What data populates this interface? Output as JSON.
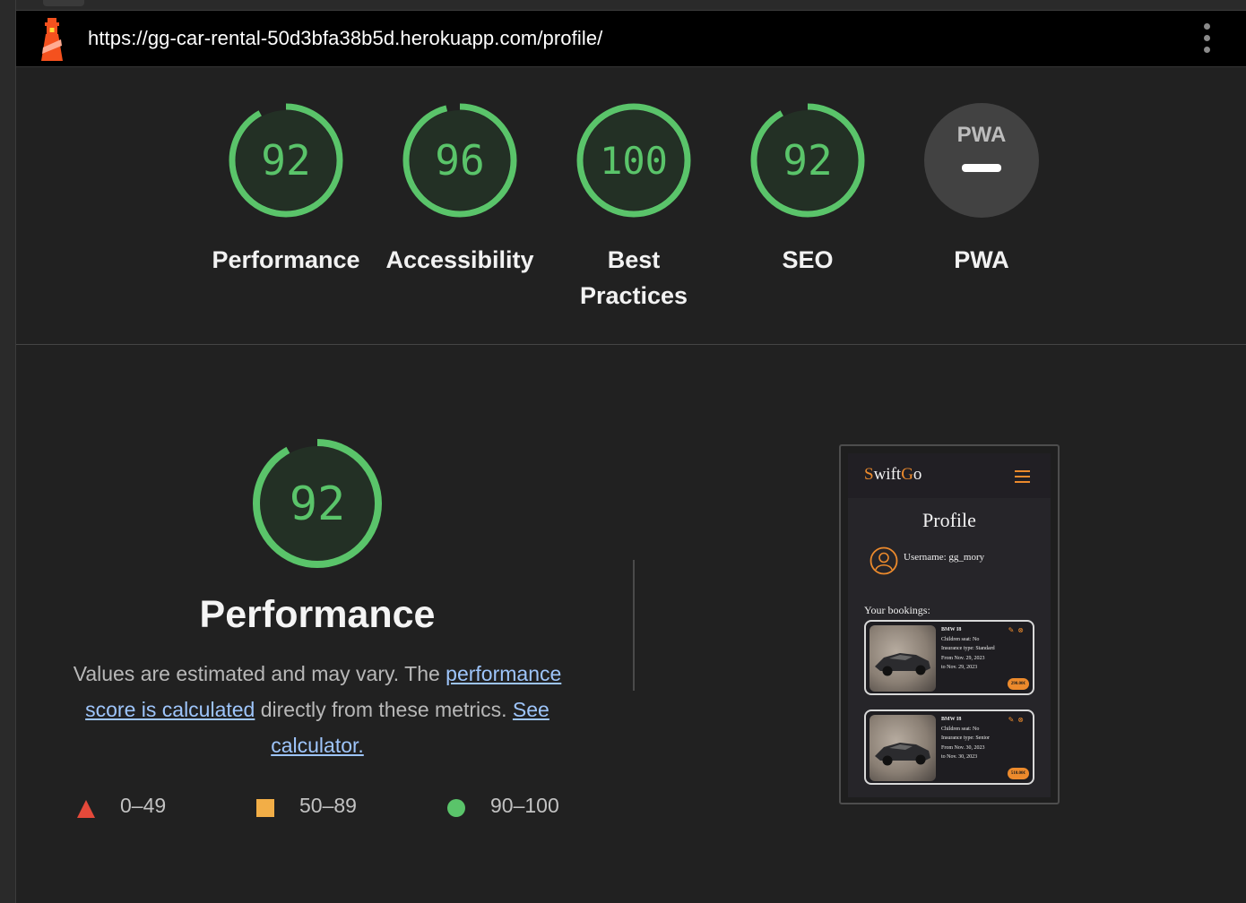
{
  "url": "https://gg-car-rental-50d3bfa38b5d.herokuapp.com/profile/",
  "colors": {
    "good": "#5ac46a",
    "average": "#f2ae47",
    "poor": "#e5493a",
    "background": "#212121",
    "link": "#9ec5fb",
    "brand_accent": "#ec8a2c"
  },
  "categories": [
    {
      "label": "Performance",
      "score": "92",
      "fraction": 0.92
    },
    {
      "label": "Accessibility",
      "score": "96",
      "fraction": 0.96
    },
    {
      "label_line1": "Best",
      "label_line2": "Practices",
      "score": "100",
      "fraction": 1.0
    },
    {
      "label": "SEO",
      "score": "92",
      "fraction": 0.92
    },
    {
      "label": "PWA",
      "badge_text": "PWA"
    }
  ],
  "performance": {
    "score": "92",
    "title": "Performance",
    "desc_before": "Values are estimated and may vary. The ",
    "link1": "performance score is calculated",
    "desc_middle": " directly from these metrics. ",
    "link2": "See calculator."
  },
  "legend": [
    {
      "range": "0–49",
      "shape": "triangle"
    },
    {
      "range": "50–89",
      "shape": "square"
    },
    {
      "range": "90–100",
      "shape": "circle"
    }
  ],
  "thumbnail": {
    "brand_first": "S",
    "brand_mid": "wift",
    "brand_g": "G",
    "brand_end": "o",
    "page_title": "Profile",
    "username": "Username: gg_mory",
    "bookings_heading": "Your bookings:",
    "bookings": [
      {
        "car": "BMW I8",
        "children_seat": "Children seat: No",
        "insurance": "Insurance type: Standard",
        "from": "From Nov. 29, 2023",
        "to": "to Nov. 29, 2023",
        "price": "290.00€"
      },
      {
        "car": "BMW I8",
        "children_seat": "Children seat: No",
        "insurance": "Insurance type: Senior",
        "from": "From Nov. 30, 2023",
        "to": "to Nov. 30, 2023",
        "price": "510.00€"
      }
    ]
  }
}
